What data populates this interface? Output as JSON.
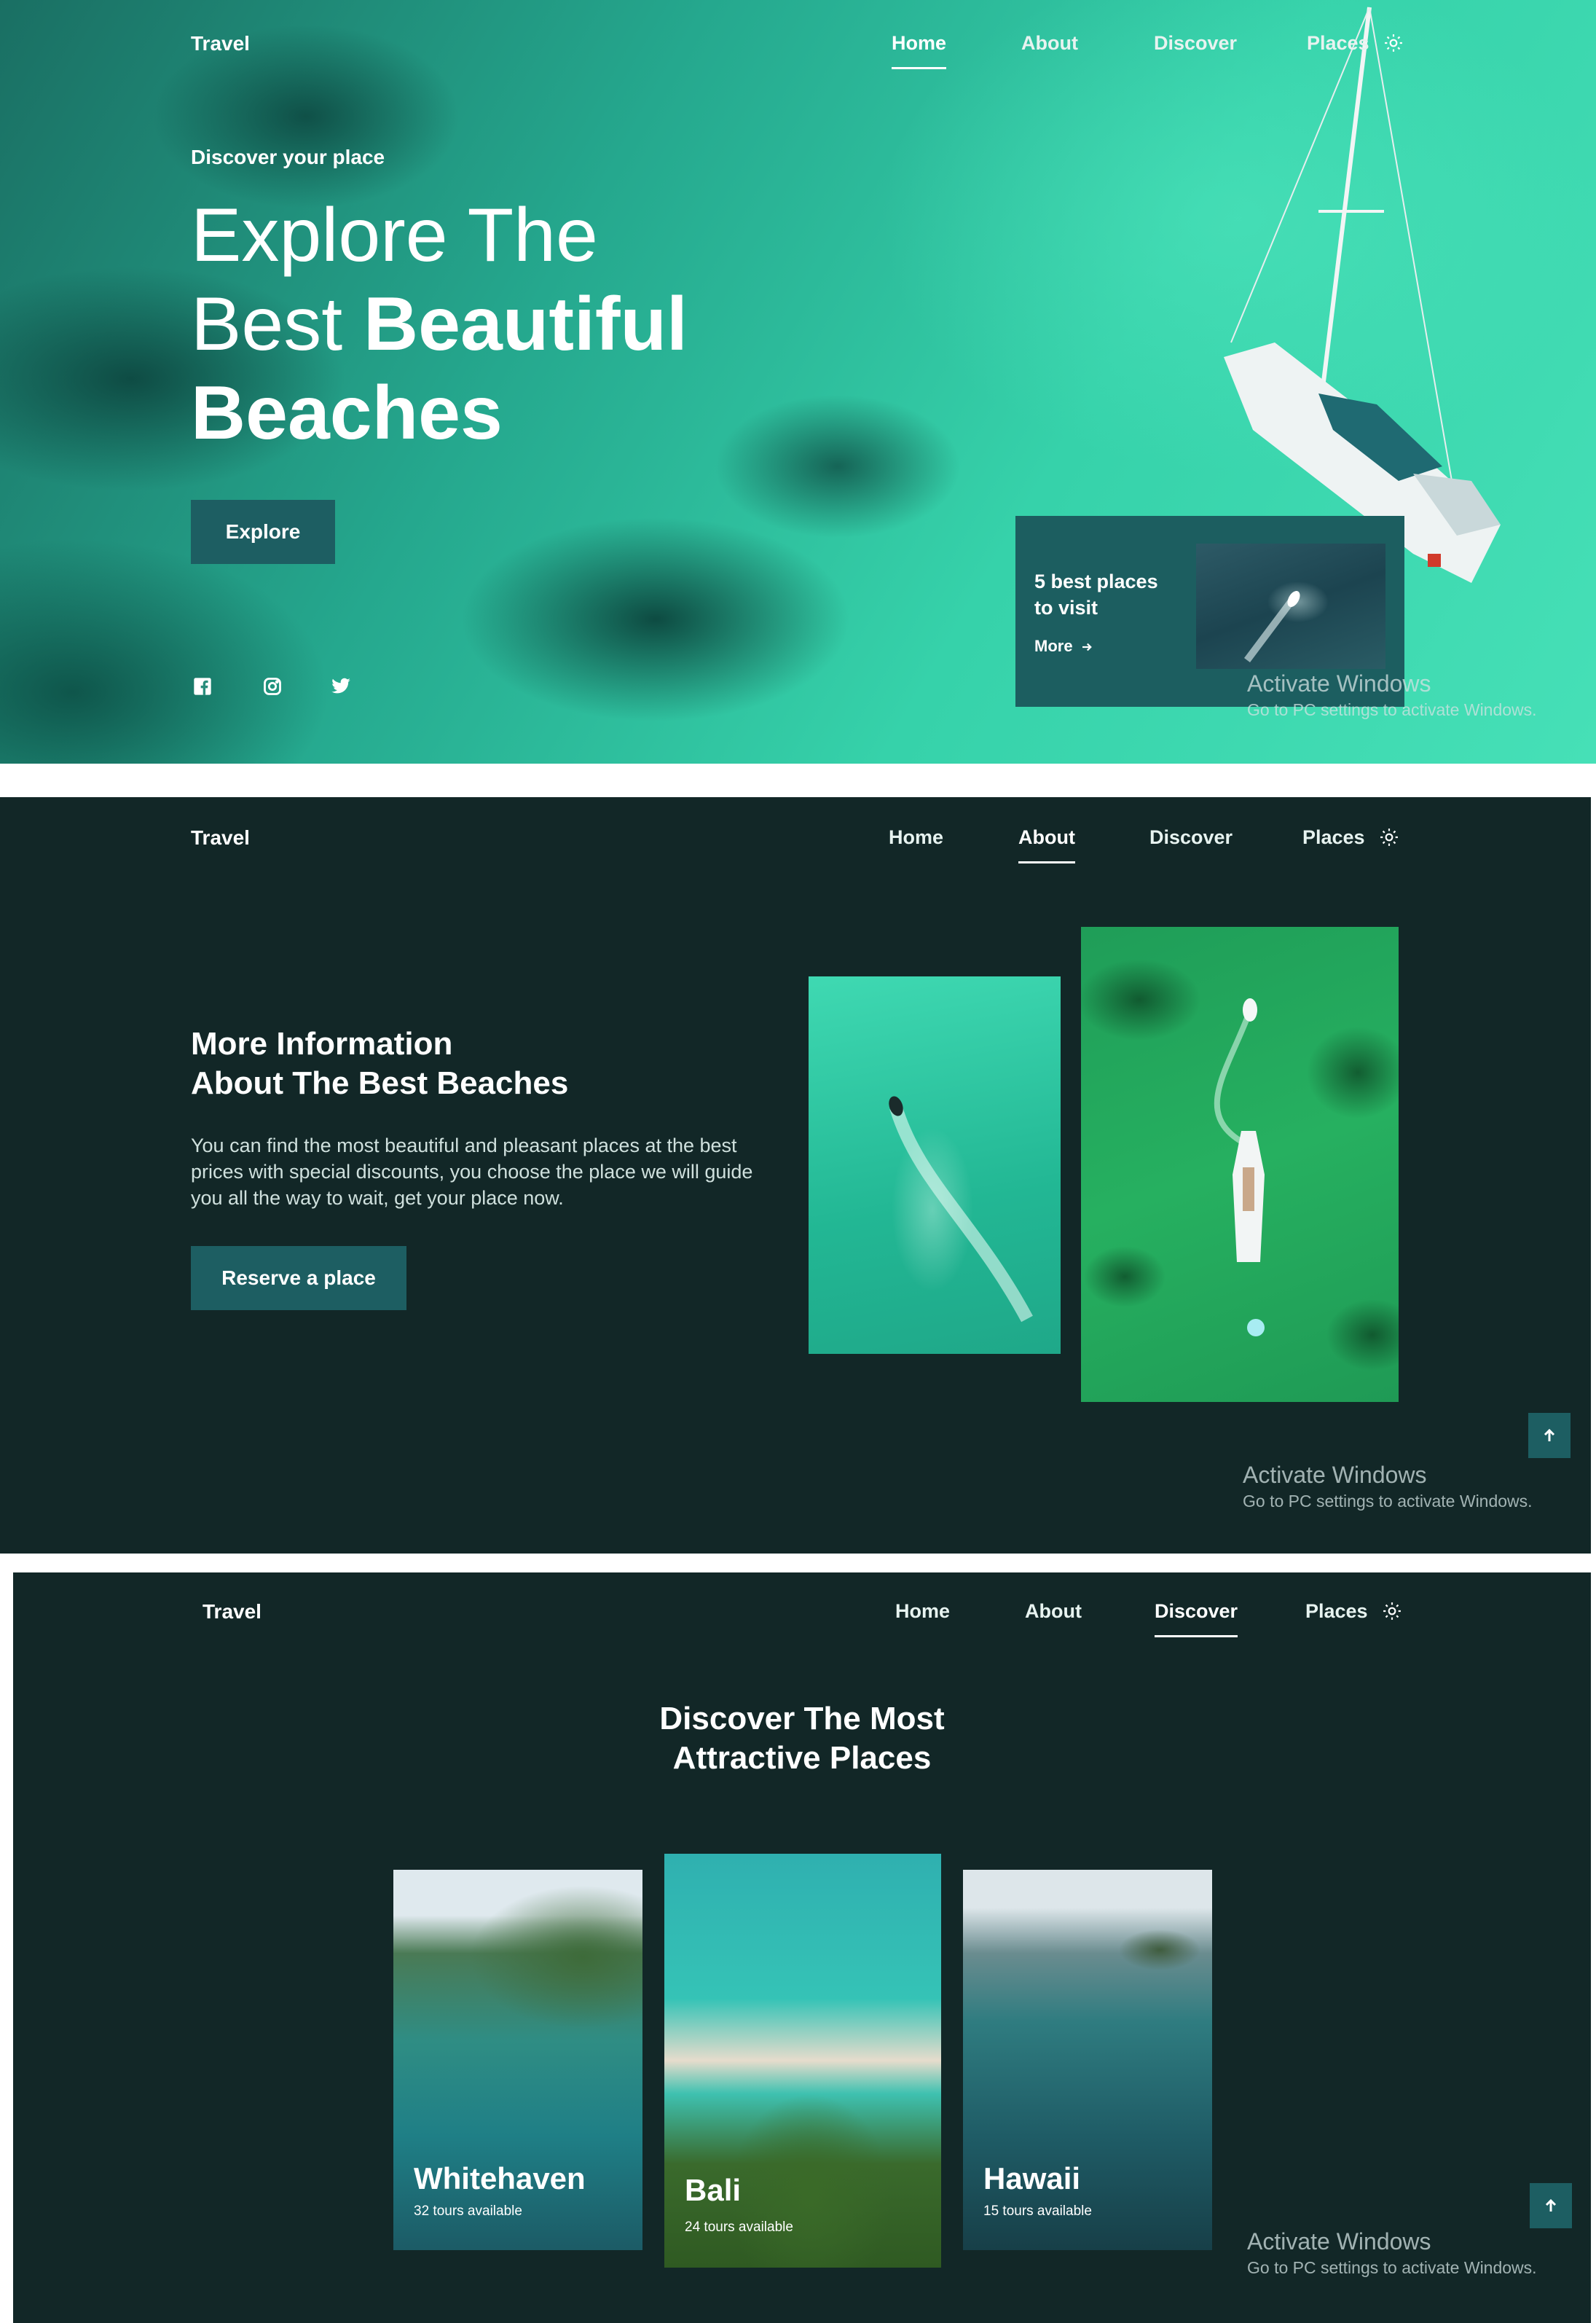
{
  "brand": "Travel",
  "nav": {
    "home": "Home",
    "about": "About",
    "discover": "Discover",
    "places": "Places"
  },
  "hero": {
    "eyebrow": "Discover your place",
    "title_line1": "Explore The",
    "title_line2_light": "Best",
    "title_line2_bold": "Beautiful",
    "title_line3": "Beaches",
    "explore_label": "Explore",
    "promo_title": "5 best places to visit",
    "promo_more": "More"
  },
  "about": {
    "title_line1": "More Information",
    "title_line2": "About The Best Beaches",
    "description": "You can find the most beautiful and pleasant places at the best prices with special discounts, you choose the place we will guide you all the way to wait, get your place now.",
    "reserve_label": "Reserve a place"
  },
  "discover": {
    "title_line1": "Discover The Most",
    "title_line2": "Attractive Places",
    "cards": [
      {
        "name": "Whitehaven",
        "tours": "32 tours available"
      },
      {
        "name": "Bali",
        "tours": "24 tours available"
      },
      {
        "name": "Hawaii",
        "tours": "15 tours available"
      }
    ]
  },
  "watermark": {
    "title": "Activate Windows",
    "subtitle": "Go to PC settings to activate Windows."
  },
  "icons": [
    "sun-icon",
    "facebook-icon",
    "instagram-icon",
    "twitter-icon",
    "arrow-right-icon",
    "arrow-up-icon"
  ],
  "colors": {
    "accent": "#1d5e62",
    "dark_bg": "#122727",
    "sea": "#36d2aa"
  }
}
